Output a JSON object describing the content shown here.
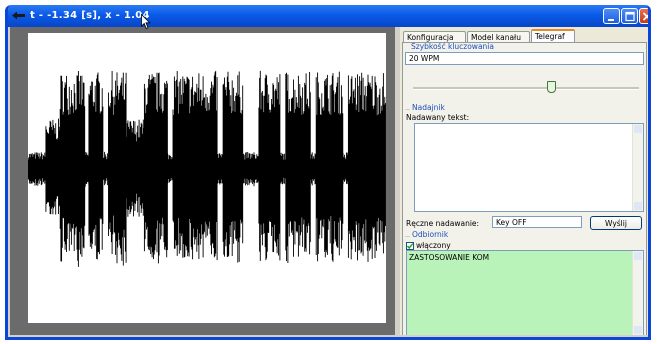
{
  "window": {
    "title": "t - -1.34 [s], x - 1.04",
    "title_bar_color": "#0a5ae8"
  },
  "icons": {
    "app": "app-icon",
    "minimize": "minimize-icon",
    "maximize": "maximize-icon",
    "close": "close-icon",
    "cursor": "mouse-pointer-icon",
    "checkbox": "check-icon"
  },
  "tabs": [
    {
      "label": "Konfiguracja",
      "active": false
    },
    {
      "label": "Model kanału",
      "active": false
    },
    {
      "label": "Telegraf",
      "active": true
    }
  ],
  "telegraf": {
    "speed_group_title": "Szybkość kluczowania",
    "speed_value": "20 WPM",
    "speed_slider_fraction": 0.61,
    "transmitter_group_title": "Nadajnik",
    "transmitted_text_label": "Nadawany tekst:",
    "transmitted_text": "",
    "manual_label": "Ręczne nadawanie:",
    "manual_value": "Key OFF",
    "send_button": "Wyślij",
    "receiver_group_title": "Odbiornik",
    "receiver_enabled_label": "włączony",
    "receiver_enabled": true,
    "received_text": "ZASTOSOWANIE KOM",
    "received_bg_color": "#b9f3b9"
  },
  "chart_data": {
    "type": "line",
    "title": "",
    "xlabel": "",
    "ylabel": "",
    "grid": false,
    "ylim": [
      -1,
      1
    ],
    "series": [
      {
        "color": "#000000",
        "segments": [
          {
            "x_start": 0.0,
            "x_end": 0.05,
            "amplitude": 0.12
          },
          {
            "x_start": 0.05,
            "x_end": 0.09,
            "amplitude": 0.35
          },
          {
            "x_start": 0.09,
            "x_end": 0.16,
            "amplitude": 0.68
          },
          {
            "x_start": 0.16,
            "x_end": 0.17,
            "amplitude": 0.12
          },
          {
            "x_start": 0.17,
            "x_end": 0.21,
            "amplitude": 0.68
          },
          {
            "x_start": 0.21,
            "x_end": 0.225,
            "amplitude": 0.12
          },
          {
            "x_start": 0.225,
            "x_end": 0.275,
            "amplitude": 0.68
          },
          {
            "x_start": 0.275,
            "x_end": 0.325,
            "amplitude": 0.35
          },
          {
            "x_start": 0.325,
            "x_end": 0.39,
            "amplitude": 0.68
          },
          {
            "x_start": 0.39,
            "x_end": 0.405,
            "amplitude": 0.12
          },
          {
            "x_start": 0.405,
            "x_end": 0.53,
            "amplitude": 0.68
          },
          {
            "x_start": 0.53,
            "x_end": 0.545,
            "amplitude": 0.12
          },
          {
            "x_start": 0.545,
            "x_end": 0.6,
            "amplitude": 0.68
          },
          {
            "x_start": 0.6,
            "x_end": 0.645,
            "amplitude": 0.12
          },
          {
            "x_start": 0.645,
            "x_end": 0.705,
            "amplitude": 0.68
          },
          {
            "x_start": 0.705,
            "x_end": 0.72,
            "amplitude": 0.12
          },
          {
            "x_start": 0.72,
            "x_end": 0.79,
            "amplitude": 0.68
          },
          {
            "x_start": 0.79,
            "x_end": 0.805,
            "amplitude": 0.12
          },
          {
            "x_start": 0.805,
            "x_end": 0.88,
            "amplitude": 0.68
          },
          {
            "x_start": 0.88,
            "x_end": 0.895,
            "amplitude": 0.12
          },
          {
            "x_start": 0.895,
            "x_end": 1.0,
            "amplitude": 0.68
          }
        ]
      }
    ]
  }
}
